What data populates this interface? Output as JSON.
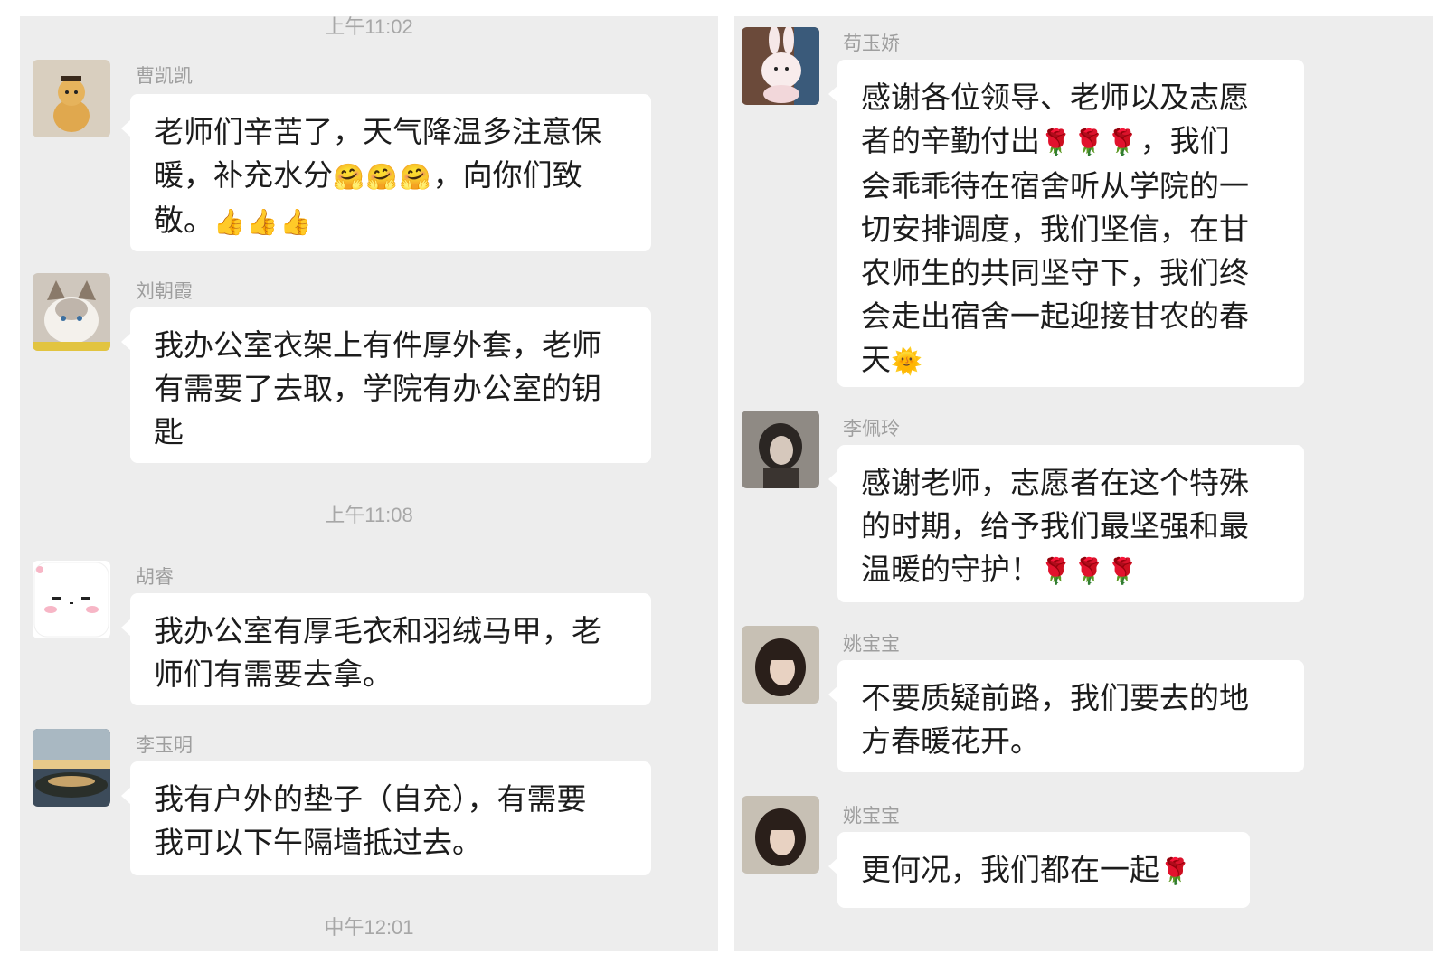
{
  "left_panel": {
    "time_top": "上午11:02",
    "time_mid": "上午11:08",
    "time_bottom": "中午12:01",
    "messages": [
      {
        "name": "曹凯凯",
        "lines": [
          "老师们辛苦了，天气降温多注意保",
          "暖，补充水分",
          "敬。"
        ],
        "emoji_a": "🤗🤗🤗",
        "text_a_tail": "，向你们致",
        "emoji_b": "👍👍👍",
        "avatar": "dog-avatar"
      },
      {
        "name": "刘朝霞",
        "lines": [
          "我办公室衣架上有件厚外套，老师",
          "有需要了去取，学院有办公室的钥",
          "匙"
        ],
        "avatar": "cat-avatar"
      },
      {
        "name": "胡睿",
        "lines": [
          "我办公室有厚毛衣和羽绒马甲，老",
          "师们有需要去拿。"
        ],
        "avatar": "cute-face-avatar"
      },
      {
        "name": "李玉明",
        "lines": [
          "我有户外的垫子（自充），有需要",
          "我可以下午隔墙抵过去。"
        ],
        "avatar": "landscape-avatar"
      }
    ]
  },
  "right_panel": {
    "messages": [
      {
        "name": "苟玉娇",
        "lines": [
          "感谢各位领导、老师以及志愿",
          "者的辛勤付出",
          "会乖乖待在宿舍听从学院的一",
          "切安排调度，我们坚信，在甘",
          "农师生的共同坚守下，我们终",
          "会走出宿舍一起迎接甘农的春",
          "天"
        ],
        "emoji_a": "🌹🌹🌹",
        "text_a_tail": "，我们",
        "emoji_b": "🌞",
        "avatar": "bunny-avatar"
      },
      {
        "name": "李佩玲",
        "lines": [
          "感谢老师，志愿者在这个特殊",
          "的时期，给予我们最坚强和最",
          "温暖的守护！"
        ],
        "emoji_a": "🌹🌹🌹",
        "avatar": "portrait-avatar"
      },
      {
        "name": "姚宝宝",
        "lines": [
          "不要质疑前路，我们要去的地",
          "方春暖花开。"
        ],
        "avatar": "girl-avatar"
      },
      {
        "name": "姚宝宝",
        "lines": [
          "更何况，我们都在一起"
        ],
        "emoji_a": "🌹",
        "avatar": "girl-avatar"
      }
    ]
  },
  "colors": {
    "panel_bg": "#ededed",
    "bubble_bg": "#ffffff",
    "name": "#9e9e9e",
    "time": "#a7a7a7"
  }
}
